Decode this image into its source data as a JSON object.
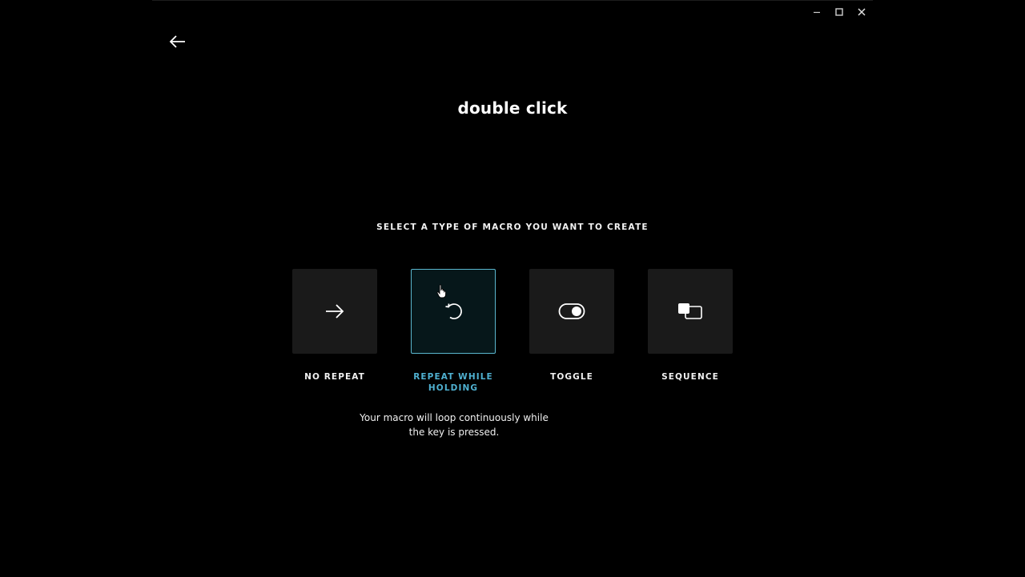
{
  "window": {
    "controls": [
      {
        "name": "minimize",
        "icon": "minimize-icon"
      },
      {
        "name": "maximize",
        "icon": "maximize-icon"
      },
      {
        "name": "close",
        "icon": "close-icon"
      }
    ]
  },
  "header": {
    "back_icon": "arrow-left-icon",
    "title": "double click"
  },
  "main": {
    "heading": "SELECT A TYPE OF MACRO YOU WANT TO CREATE",
    "options": [
      {
        "label": "NO REPEAT",
        "icon": "arrow-right-icon",
        "selected": false
      },
      {
        "label": "REPEAT WHILE HOLDING",
        "icon": "repeat-icon",
        "selected": true
      },
      {
        "label": "TOGGLE",
        "icon": "toggle-icon",
        "selected": false
      },
      {
        "label": "SEQUENCE",
        "icon": "sequence-icon",
        "selected": false
      }
    ],
    "description": "Your macro will loop continuously while the key is pressed."
  },
  "colors": {
    "background": "#000000",
    "tile": "#1a1a1a",
    "selected_border": "#5ab7cf",
    "selected_text": "#4fb0d0"
  }
}
